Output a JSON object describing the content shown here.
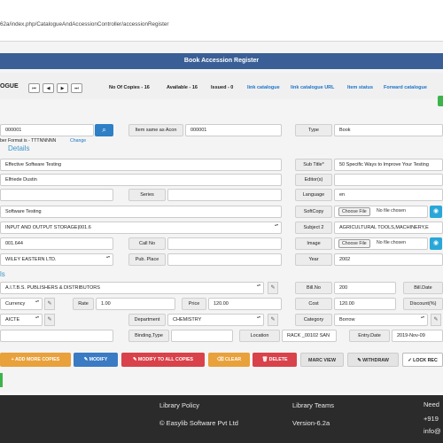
{
  "browser": {
    "url": "62a/index.php/CatalogueAndAccessionController/accessionRegister"
  },
  "header": {
    "title": "Book Accession Register"
  },
  "toolbar": {
    "heading": "OGUE",
    "nav": {
      "first": "⏮",
      "prev": "◀",
      "next": "▶",
      "last": "⏭"
    },
    "copies": "No Of Copies - 16",
    "available": "Available - 16",
    "issued": "Issued - 0",
    "links": [
      "link catalogue",
      "link catalogue URL",
      "Item status",
      "Forward catalogue"
    ]
  },
  "form": {
    "accession_no": "000001",
    "number_format_note": "ber Format is - TTTNNNNN",
    "change_link": "Change",
    "item_same_label": "Item same as Acon",
    "item_same_value": "000001",
    "type_label": "Type",
    "type_value": "Book",
    "details_heading": "Details",
    "title": "Effective Software Testing",
    "subtitle_label": "Sub Title*",
    "subtitle_value": "50 Specific Ways to Improve Your Testing",
    "author": "Elfriede Dustin",
    "editors_label": "Editor(s)",
    "editors_value": "",
    "row3_value": "",
    "series_label": "Series",
    "series_value": "",
    "language_label": "Language",
    "language_value": "en",
    "subject": "Software Testing",
    "softcopy_label": "SoftCopy",
    "choose_file": "Choose File",
    "no_file": "No file chosen",
    "subject_dept": "INPUT AND OUTPUT STORAGE|001.6",
    "subject2_label": "Subject 2",
    "subject2_value": "AGRICULTURAL TOOLS,MACHINERY,E",
    "classno": "001.644",
    "callno_label": "Call No",
    "callno_value": "",
    "image_label": "Image",
    "publisher": "WILEY EASTERN LTD.",
    "pubplace_label": "Pub. Place",
    "pubplace_value": "",
    "year_label": "Year",
    "year_value": "2002",
    "ls_heading": "ls",
    "vendor": "A.I.T.B.S. PUBLISHERS & DISTRIBUTORS",
    "billno_label": "Bill.No",
    "billno_value": "200",
    "billdate_label": "Bill.Date",
    "currency": "Currency",
    "rate_label": "Rate",
    "rate_value": "1.00",
    "price_label": "Price",
    "price_value": "120.00",
    "cost_label": "Cost",
    "cost_value": "120.00",
    "discount_label": "Discount(%)",
    "budget": "AICTE",
    "department_label": "Department",
    "department_value": "CHEMISTRY",
    "category_label": "Category",
    "category_value": "Borrow",
    "row_last_value": "",
    "binding_label": "Binding,Type",
    "binding_value": "",
    "location_label": "Location",
    "location_value": "RACK _00102 SAN",
    "entrydate_label": "Entry.Date",
    "entrydate_value": "2019-Nov-09"
  },
  "actions": {
    "add_more": "+ ADD MORE COPIES",
    "modify": "✎ MODIFY",
    "modify_all": "✎ MODIFY TO ALL COPIES",
    "clear": "⌫ CLEAR",
    "delete": "🗑 DELETE",
    "marc_view": "MARC VIEW",
    "withdraw": "✎ WITHDRAW",
    "lock": "✓ LOCK REC"
  },
  "footer": {
    "policy": "Library Policy",
    "copyright": "© Easylib Software Pvt Ltd",
    "teams": "Library Teams",
    "version": "Version-6.2a",
    "need": "Need",
    "phone": "+919",
    "email": "info@"
  },
  "colors": {
    "header_blue": "#3a5f96",
    "link_blue": "#1a73c8",
    "section_blue": "#3c94c9",
    "footer": "#2b2b2b"
  }
}
